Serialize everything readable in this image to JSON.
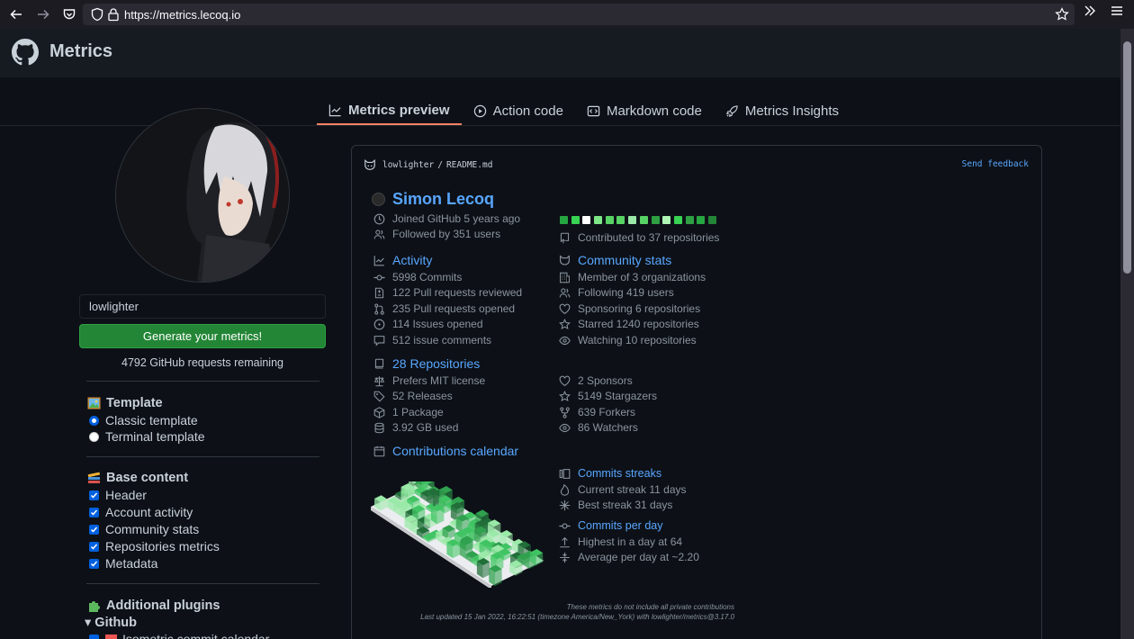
{
  "browser": {
    "url": "https://metrics.lecoq.io"
  },
  "app": {
    "title": "Metrics"
  },
  "tabs": [
    {
      "label": "Metrics preview",
      "active": true
    },
    {
      "label": "Action code"
    },
    {
      "label": "Markdown code"
    },
    {
      "label": "Metrics Insights"
    }
  ],
  "sidebar": {
    "username_value": "lowlighter",
    "generate_label": "Generate your metrics!",
    "remaining": "4792 GitHub requests remaining",
    "template_title": "Template",
    "template_options": [
      {
        "label": "Classic template",
        "selected": true
      },
      {
        "label": "Terminal template",
        "selected": false
      }
    ],
    "base_title": "Base content",
    "base_options": [
      "Header",
      "Account activity",
      "Community stats",
      "Repositories metrics",
      "Metadata"
    ],
    "plugins_title": "Additional plugins",
    "plugins_group": "▾ Github",
    "plugin_item": "Isometric commit calendar"
  },
  "card": {
    "path_user": "lowlighter",
    "path_sep": "/",
    "path_file": "README.md",
    "feedback": "Send feedback",
    "name": "Simon Lecoq",
    "joined": "Joined GitHub 5 years ago",
    "followed": "Followed by 351 users",
    "contributed": "Contributed to 37 repositories",
    "activity": {
      "title": "Activity",
      "items": [
        "5998 Commits",
        "122 Pull requests reviewed",
        "235 Pull requests opened",
        "114 Issues opened",
        "512 issue comments"
      ]
    },
    "community": {
      "title": "Community stats",
      "items": [
        "Member of 3 organizations",
        "Following 419 users",
        "Sponsoring 6 repositories",
        "Starred 1240 repositories",
        "Watching 10 repositories"
      ]
    },
    "repositories": {
      "title": "28 Repositories",
      "items": [
        "Prefers MIT license",
        "52 Releases",
        "1 Package",
        "3.92 GB used"
      ],
      "items_right": [
        "2 Sponsors",
        "5149 Stargazers",
        "639 Forkers",
        "86 Watchers"
      ]
    },
    "calendar": {
      "title": "Contributions calendar",
      "colors": [
        "#26a641",
        "#39d353",
        "#ffffff",
        "#7ee787",
        "#56d364",
        "#56d364",
        "#9be9a8",
        "#56d364",
        "#2ea043",
        "#aff5b4",
        "#39d353",
        "#2ea043",
        "#26a641",
        "#238636"
      ]
    },
    "streaks": {
      "title": "Commits streaks",
      "current": "Current streak 11 days",
      "best": "Best streak 31 days"
    },
    "per_day": {
      "title": "Commits per day",
      "highest": "Highest in a day at 64",
      "average": "Average per day at ~2.20"
    },
    "footnote": "These metrics do not include all private contributions",
    "updated": "Last updated 15 Jan 2022, 16:22:51 (timezone America/New_York) with lowlighter/metrics@3.17.0"
  },
  "colors": {
    "accent": "#58a6ff",
    "button": "#238636",
    "tab_underline": "#f78166"
  }
}
